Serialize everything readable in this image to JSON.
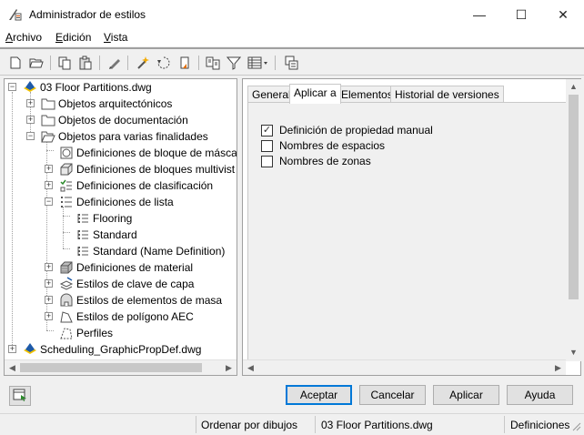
{
  "window": {
    "title": "Administrador de estilos",
    "minimize_glyph": "—",
    "maximize_glyph": "☐",
    "close_glyph": "✕"
  },
  "menubar": {
    "items": [
      {
        "label": "Archivo",
        "accel": "A",
        "rest": "rchivo"
      },
      {
        "label": "Edición",
        "accel": "E",
        "rest": "dición"
      },
      {
        "label": "Vista",
        "accel": "V",
        "rest": "ista"
      }
    ]
  },
  "toolbar": {
    "icons": [
      "new-drawing-icon",
      "open-drawing-icon",
      "copy-icon",
      "paste-icon",
      "edit-style-icon",
      "new-style-icon",
      "purge-styles-icon",
      "set-from-icon",
      "compare-icon",
      "filter-icon",
      "view-options-icon",
      "toggle-view-icon"
    ]
  },
  "tree": {
    "items": [
      {
        "label": "03 Floor Partitions.dwg",
        "level": 0,
        "expander": "−",
        "icon": "drawing-icon"
      },
      {
        "label": "Objetos arquitectónicos",
        "level": 1,
        "expander": "+",
        "icon": "folder-icon"
      },
      {
        "label": "Objetos de documentación",
        "level": 1,
        "expander": "+",
        "icon": "folder-icon"
      },
      {
        "label": "Objetos para varias finalidades",
        "level": 1,
        "expander": "−",
        "icon": "folder-icon"
      },
      {
        "label": "Definiciones de bloque de másca",
        "level": 2,
        "expander": "",
        "icon": "mask-block-icon"
      },
      {
        "label": "Definiciones de bloques multivist",
        "level": 2,
        "expander": "+",
        "icon": "multiview-block-icon"
      },
      {
        "label": "Definiciones de clasificación",
        "level": 2,
        "expander": "+",
        "icon": "classification-icon"
      },
      {
        "label": "Definiciones de lista",
        "level": 2,
        "expander": "−",
        "icon": "list-definition-icon"
      },
      {
        "label": "Flooring",
        "level": 3,
        "expander": "",
        "icon": "list-item-icon"
      },
      {
        "label": "Standard",
        "level": 3,
        "expander": "",
        "icon": "list-item-icon"
      },
      {
        "label": "Standard (Name Definition)",
        "level": 3,
        "expander": "",
        "icon": "list-item-icon"
      },
      {
        "label": "Definiciones de material",
        "level": 2,
        "expander": "+",
        "icon": "material-icon"
      },
      {
        "label": "Estilos de clave de capa",
        "level": 2,
        "expander": "+",
        "icon": "layer-key-icon"
      },
      {
        "label": "Estilos de elementos de masa",
        "level": 2,
        "expander": "+",
        "icon": "mass-element-icon"
      },
      {
        "label": "Estilos de polígono AEC",
        "level": 2,
        "expander": "+",
        "icon": "polygon-icon"
      },
      {
        "label": "Perfiles",
        "level": 2,
        "expander": "",
        "icon": "profile-icon"
      },
      {
        "label": "Scheduling_GraphicPropDef.dwg",
        "level": 0,
        "expander": "+",
        "icon": "drawing-icon"
      }
    ]
  },
  "tabs": [
    {
      "label": "General"
    },
    {
      "label": "Aplicar a"
    },
    {
      "label": "Elementos"
    },
    {
      "label": "Historial de versiones"
    }
  ],
  "applies_to": {
    "items": [
      {
        "label": "Definición de propiedad manual",
        "checked": true,
        "mark": "✓"
      },
      {
        "label": "Nombres de espacios",
        "checked": false,
        "mark": ""
      },
      {
        "label": "Nombres de zonas",
        "checked": false,
        "mark": ""
      }
    ]
  },
  "buttons": {
    "ok": "Aceptar",
    "cancel": "Cancelar",
    "apply": "Aplicar",
    "help": "Ayuda"
  },
  "status": {
    "sort": "Ordenar por dibujos",
    "drawing": "03 Floor Partitions.dwg",
    "type": "Definiciones"
  },
  "colors": {
    "accent": "#0078d7",
    "folder": "#e8c36a",
    "drawing_blue": "#1e5aa8",
    "drawing_yellow": "#f2c200"
  }
}
